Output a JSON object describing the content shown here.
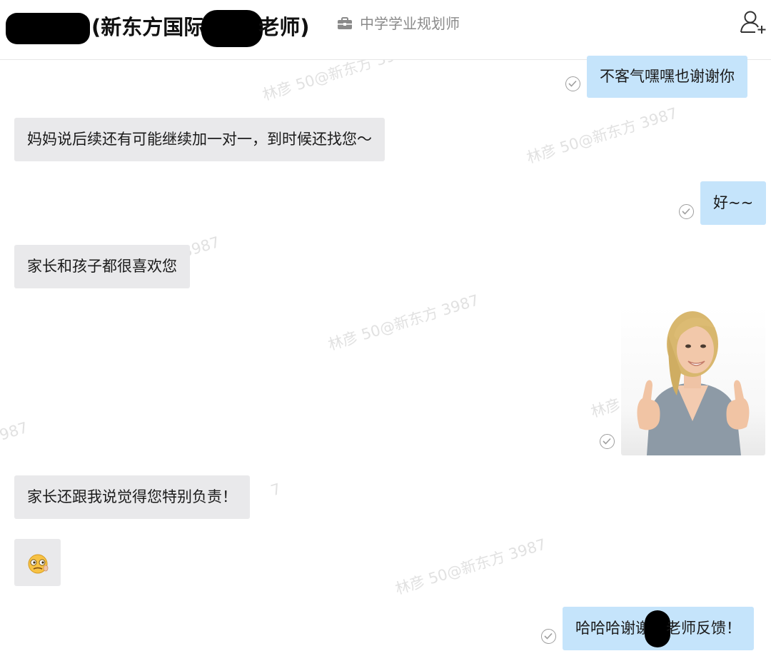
{
  "header": {
    "name_visible": "(新东方国际",
    "name_suffix": "老师)",
    "role": "中学学业规划师"
  },
  "messages": [
    {
      "side": "out",
      "text": "不客气嘿嘿也谢谢你",
      "status": "read"
    },
    {
      "side": "in",
      "text": "妈妈说后续还有可能继续加一对一，到时候还找您～"
    },
    {
      "side": "out",
      "text": "好~~",
      "status": "read"
    },
    {
      "side": "in",
      "text": "家长和孩子都很喜欢您"
    },
    {
      "side": "out",
      "type": "image",
      "image": "thumbs-up-woman-photo",
      "status": "read"
    },
    {
      "side": "in",
      "text": "家长还跟我说觉得您特别负责！"
    },
    {
      "side": "in",
      "type": "emoji",
      "emoji": "emoji-face-icon"
    },
    {
      "side": "out",
      "text_before": "哈哈哈谢谢",
      "text_after": "老师反馈！",
      "status": "read"
    }
  ],
  "watermarks": [
    "林彦 50@新东方 3987",
    "林彦 50@新东方 3987",
    "林彦 50@新东方 3987",
    "林彦 50@新东方 3987",
    "3987",
    "林彦",
    "987",
    "7"
  ],
  "colors": {
    "incoming_bubble": "#e9e9eb",
    "outgoing_bubble": "#c5e4fb",
    "role_text": "#8a8a8a"
  }
}
